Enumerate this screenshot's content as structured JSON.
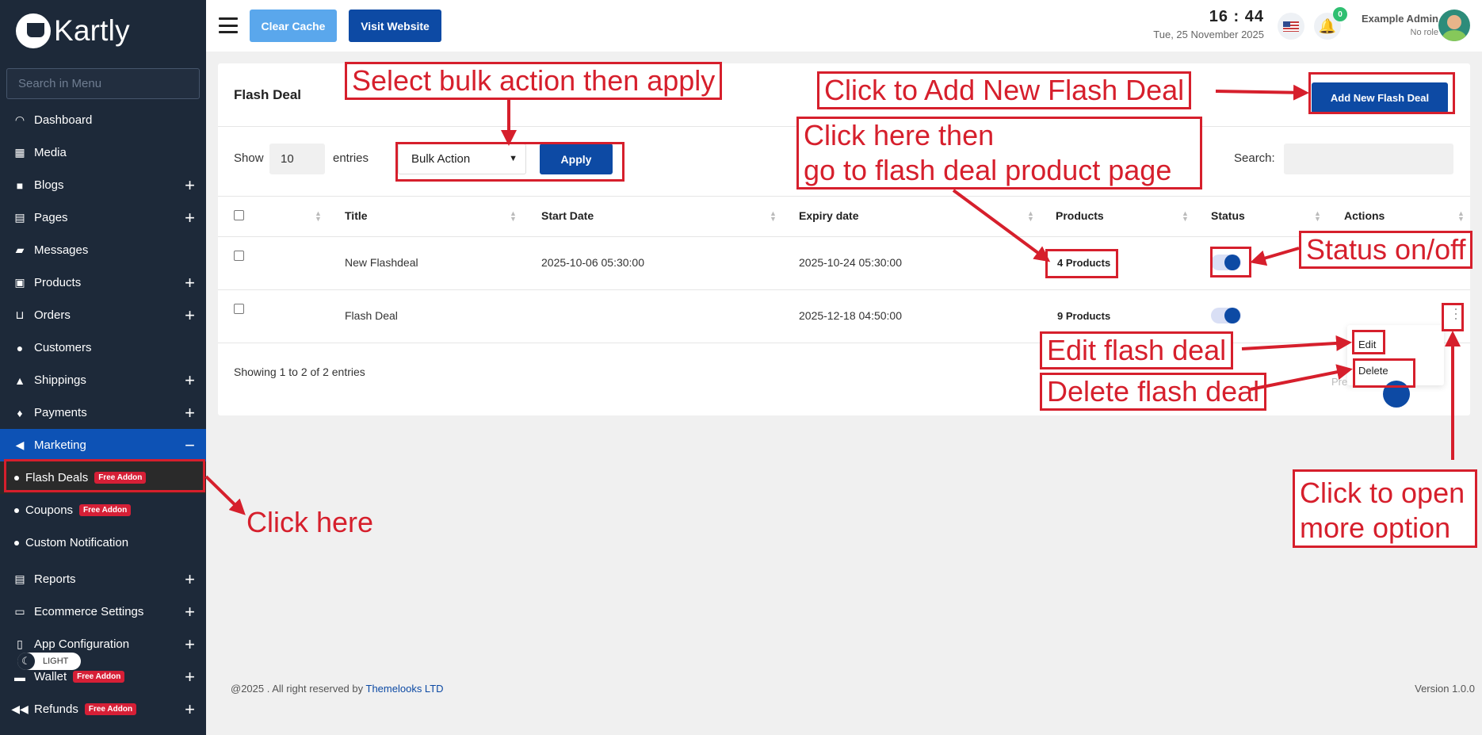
{
  "app": {
    "logo_text": "Kartly"
  },
  "sidebar": {
    "search_placeholder": "Search in Menu",
    "items": [
      {
        "label": "Dashboard",
        "icon": "dashboard-icon",
        "expandable": false
      },
      {
        "label": "Media",
        "icon": "media-icon",
        "expandable": false
      },
      {
        "label": "Blogs",
        "icon": "blog-icon",
        "expandable": true
      },
      {
        "label": "Pages",
        "icon": "pages-icon",
        "expandable": true
      },
      {
        "label": "Messages",
        "icon": "inbox-icon",
        "expandable": false
      },
      {
        "label": "Products",
        "icon": "products-icon",
        "expandable": true
      },
      {
        "label": "Orders",
        "icon": "cart-icon",
        "expandable": true
      },
      {
        "label": "Customers",
        "icon": "users-icon",
        "expandable": false
      },
      {
        "label": "Shippings",
        "icon": "ship-icon",
        "expandable": true
      },
      {
        "label": "Payments",
        "icon": "money-bag-icon",
        "expandable": true
      },
      {
        "label": "Marketing",
        "icon": "megaphone-icon",
        "expandable": true,
        "expanded": true
      }
    ],
    "marketing_sub": [
      {
        "label": "Flash Deals",
        "badge": "Free Addon"
      },
      {
        "label": "Coupons",
        "badge": "Free Addon"
      },
      {
        "label": "Custom Notification",
        "badge": ""
      }
    ],
    "items_after": [
      {
        "label": "Reports",
        "icon": "report-icon",
        "badge": ""
      },
      {
        "label": "Ecommerce Settings",
        "icon": "window-icon",
        "badge": ""
      },
      {
        "label": "App Configuration",
        "icon": "mobile-icon",
        "badge": ""
      },
      {
        "label": "Wallet",
        "icon": "wallet-icon",
        "badge": "Free Addon"
      },
      {
        "label": "Refunds",
        "icon": "rewind-icon",
        "badge": "Free Addon"
      }
    ],
    "theme_label": "LIGHT"
  },
  "topbar": {
    "clear_cache": "Clear Cache",
    "visit_website": "Visit Website",
    "time": "16 : 44",
    "date": "Tue, 25 November 2025",
    "notification_count": "0",
    "user_name": "Example Admin",
    "user_role": "No role"
  },
  "card": {
    "title": "Flash Deal",
    "add_button": "Add New Flash Deal",
    "show_label": "Show",
    "entries_value": "10",
    "entries_label": "entries",
    "bulk_action": "Bulk Action",
    "apply": "Apply",
    "search_label": "Search:",
    "columns": [
      "Title",
      "Start Date",
      "Expiry date",
      "Products",
      "Status",
      "Actions"
    ],
    "rows": [
      {
        "title": "New Flashdeal",
        "start": "2025-10-06 05:30:00",
        "expiry": "2025-10-24 05:30:00",
        "products": "4 Products",
        "status_on": true
      },
      {
        "title": "Flash Deal",
        "start": "",
        "expiry": "2025-12-18 04:50:00",
        "products": "9 Products",
        "status_on": true
      }
    ],
    "menu_edit": "Edit",
    "menu_delete": "Delete",
    "showing": "Showing 1 to 2 of 2 entries",
    "prev": "Pre"
  },
  "footer": {
    "copyright": "@2025 . All right reserved by",
    "company": "Themelooks LTD",
    "version": "Version 1.0.0"
  },
  "annotations": {
    "bulk": "Select bulk action then apply",
    "add": "Click to Add New Flash Deal",
    "products_line1": "Click here then",
    "products_line2": "go to flash deal product page",
    "status": "Status on/off",
    "edit": "Edit flash deal",
    "delete": "Delete flash deal",
    "more_line1": "Click to open",
    "more_line2": "more option",
    "click_here": "Click here",
    "color": "#d61f2c"
  }
}
